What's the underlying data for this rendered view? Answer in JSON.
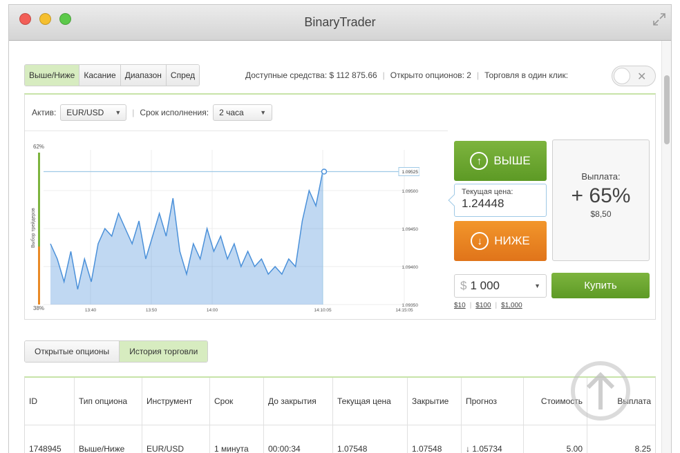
{
  "window": {
    "title": "BinaryTrader"
  },
  "option_tabs": [
    {
      "label": "Выше/Ниже",
      "active": true
    },
    {
      "label": "Касание",
      "active": false
    },
    {
      "label": "Диапазон",
      "active": false
    },
    {
      "label": "Спред",
      "active": false
    }
  ],
  "stats": {
    "funds": "Доступные средства: $ 112 875.66",
    "open_options": "Открыто опционов: 2",
    "one_click": "Торговля в один клик:"
  },
  "selectors": {
    "asset_label": "Актив:",
    "asset_value": "EUR/USD",
    "expiry_label": "Срок исполнения:",
    "expiry_value": "2 часа"
  },
  "chart_data": {
    "type": "area",
    "ylabel": "Выбор трейдеров",
    "sentiment_top": "62%",
    "sentiment_bottom": "38%",
    "x_ticks": [
      "13:40",
      "13:50",
      "14:00",
      "14:10:05",
      "14:15:05"
    ],
    "y_ticks": [
      "1.09525",
      "1.09500",
      "1.09450",
      "1.09400",
      "1.09350"
    ],
    "ylim": [
      1.0935,
      1.0955
    ],
    "current_marker": "1.09525",
    "values": [
      1.0943,
      1.0941,
      1.0938,
      1.0942,
      1.0937,
      1.0941,
      1.0938,
      1.0943,
      1.0945,
      1.0944,
      1.0947,
      1.0945,
      1.0943,
      1.0946,
      1.0941,
      1.0944,
      1.0947,
      1.0944,
      1.0949,
      1.0942,
      1.0939,
      1.0943,
      1.0941,
      1.0945,
      1.0942,
      1.0944,
      1.0941,
      1.0943,
      1.094,
      1.0942,
      1.094,
      1.0941,
      1.0939,
      1.094,
      1.0939,
      1.0941,
      1.094,
      1.0946,
      1.095,
      1.0948,
      1.09525
    ]
  },
  "trade": {
    "up_label": "ВЫШЕ",
    "down_label": "НИЖЕ",
    "current_price_label": "Текущая цена:",
    "current_price": "1.24448",
    "payout_label": "Выплата:",
    "payout_pct": "+ 65%",
    "payout_amount": "$8,50",
    "amount_currency": "$",
    "amount_value": "1 000",
    "presets": [
      "$10",
      "$100",
      "$1,000"
    ],
    "buy_label": "Купить"
  },
  "bottom_tabs": [
    {
      "label": "Открытые опционы",
      "active": false
    },
    {
      "label": "История торговли",
      "active": true
    }
  ],
  "table": {
    "headers": [
      "ID",
      "Тип опциона",
      "Инструмент",
      "Срок",
      "До закрытия",
      "Текущая цена",
      "Закрытие",
      "Прогноз",
      "Стоимость",
      "Выплата"
    ],
    "rows": [
      [
        "1748945",
        "Выше/Ниже",
        "EUR/USD",
        "1 минута",
        "00:00:34",
        "1.07548",
        "1.07548",
        "↓ 1.05734",
        "5.00",
        "8.25"
      ]
    ]
  },
  "colors": {
    "up": "#6aa52e",
    "down": "#ea8120",
    "accent_green": "#d7ecc0",
    "line": "#4a90d9"
  }
}
